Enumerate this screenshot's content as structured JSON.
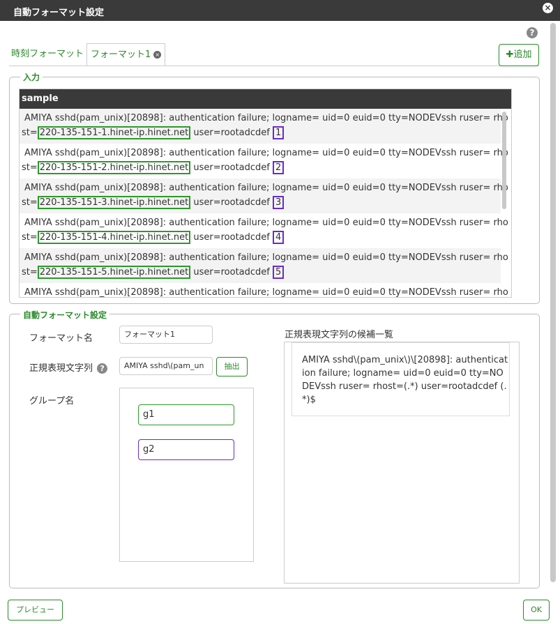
{
  "dialog": {
    "title": "自動フォーマット設定",
    "close_icon": "×",
    "help_icon": "?"
  },
  "tabs": [
    {
      "label": "時刻フォーマット"
    },
    {
      "label": "フォーマット1",
      "close_icon": "×"
    }
  ],
  "add_button": {
    "icon": "✚",
    "label": "追加"
  },
  "input_section": {
    "legend": "入力",
    "table_header": "sample",
    "rows": [
      {
        "line1": "AMIYA sshd(pam_unix)[20898]: authentication failure; logname= uid=0 euid=0 tty=NODEVssh ruser= rho",
        "prefix": "st=",
        "host": "220-135-151-1.hinet-ip.hinet.net",
        "user": " user=rootadcdef ",
        "num": "1"
      },
      {
        "line1": "AMIYA sshd(pam_unix)[20898]: authentication failure; logname= uid=0 euid=0 tty=NODEVssh ruser= rho",
        "prefix": "st=",
        "host": "220-135-151-2.hinet-ip.hinet.net",
        "user": " user=rootadcdef ",
        "num": "2"
      },
      {
        "line1": "AMIYA sshd(pam_unix)[20898]: authentication failure; logname= uid=0 euid=0 tty=NODEVssh ruser= rho",
        "prefix": "st=",
        "host": "220-135-151-3.hinet-ip.hinet.net",
        "user": " user=rootadcdef ",
        "num": "3"
      },
      {
        "line1": "AMIYA sshd(pam_unix)[20898]: authentication failure; logname= uid=0 euid=0 tty=NODEVssh ruser= rho",
        "prefix": "st=",
        "host": "220-135-151-4.hinet-ip.hinet.net",
        "user": " user=rootadcdef ",
        "num": "4"
      },
      {
        "line1": "AMIYA sshd(pam_unix)[20898]: authentication failure; logname= uid=0 euid=0 tty=NODEVssh ruser= rho",
        "prefix": "st=",
        "host": "220-135-151-5.hinet-ip.hinet.net",
        "user": " user=rootadcdef ",
        "num": "5"
      },
      {
        "line1": "AMIYA sshd(pam_unix)[20898]: authentication failure; logname= uid=0 euid=0 tty=NODEVssh ruser= rho",
        "prefix": "",
        "host": "",
        "user": "",
        "num": ""
      }
    ]
  },
  "auto_format": {
    "legend": "自動フォーマット設定",
    "format_name_label": "フォーマット名",
    "format_name_value": "フォーマット1",
    "regex_label": "正規表現文字列",
    "regex_help_icon": "?",
    "regex_value": "AMIYA sshd\\(pam_un",
    "extract_button": "抽出",
    "group_label": "グループ名",
    "groups": [
      "g1",
      "g2"
    ],
    "candidates_label": "正規表現文字列の候補一覧",
    "candidate": "AMIYA sshd\\(pam_unix\\)\\[20898]: authentication failure; logname= uid=0 euid=0 tty=NODEVssh ruser= rhost=(.*) user=rootadcdef (.*)$"
  },
  "footer": {
    "preview_button": "プレビュー",
    "ok_button": "OK"
  },
  "colors": {
    "accent": "#2a8a2a",
    "group1": "#2a9a2a",
    "group2": "#6a2acb",
    "header": "#3a3a3a"
  }
}
